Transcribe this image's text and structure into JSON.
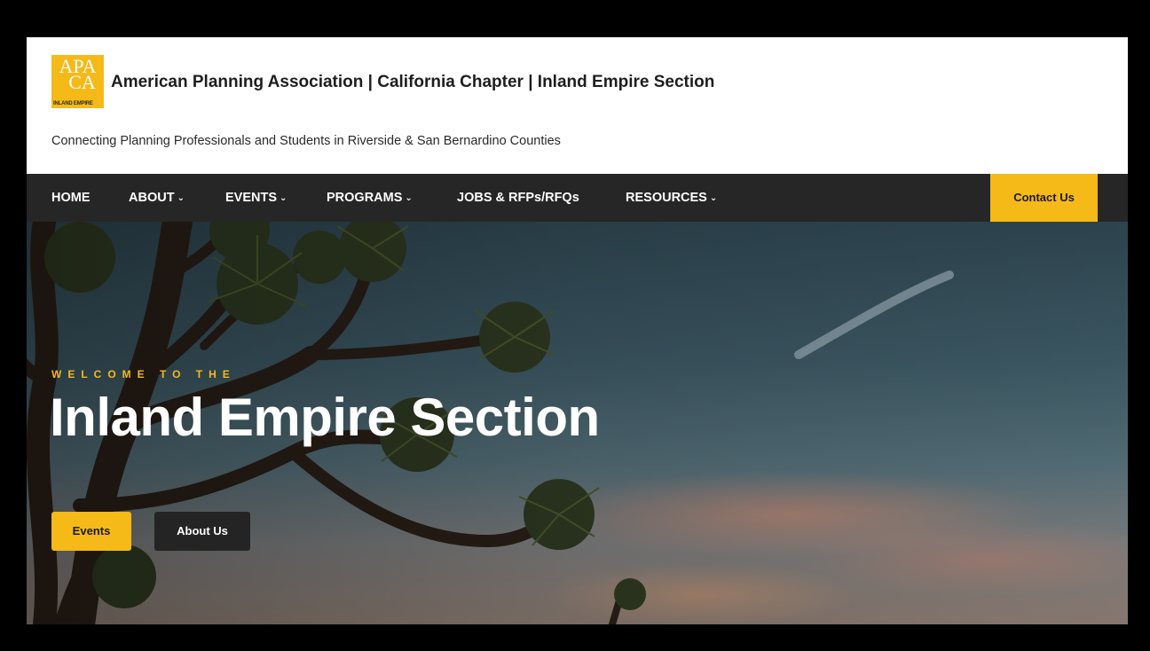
{
  "logo": {
    "line1": "APA",
    "line2": "CA",
    "line3": "INLAND EMPIRE"
  },
  "header": {
    "title": "American Planning Association | California Chapter | Inland Empire Section",
    "tagline": "Connecting Planning Professionals and Students in Riverside & San Bernardino Counties"
  },
  "nav": {
    "items": [
      {
        "label": "HOME",
        "dropdown": false
      },
      {
        "label": "ABOUT",
        "dropdown": true
      },
      {
        "label": "EVENTS",
        "dropdown": true
      },
      {
        "label": "PROGRAMS",
        "dropdown": true
      },
      {
        "label": "JOBS & RFPs/RFQs",
        "dropdown": false
      },
      {
        "label": "RESOURCES",
        "dropdown": true
      }
    ],
    "chevron": "⌄",
    "contact_label": "Contact Us"
  },
  "hero": {
    "eyebrow": "WELCOME TO THE",
    "title": "Inland Empire Section",
    "buttons": {
      "events": "Events",
      "about": "About Us"
    }
  },
  "colors": {
    "accent": "#f5b918",
    "nav_bg": "#262626",
    "dark_button": "#242424"
  }
}
